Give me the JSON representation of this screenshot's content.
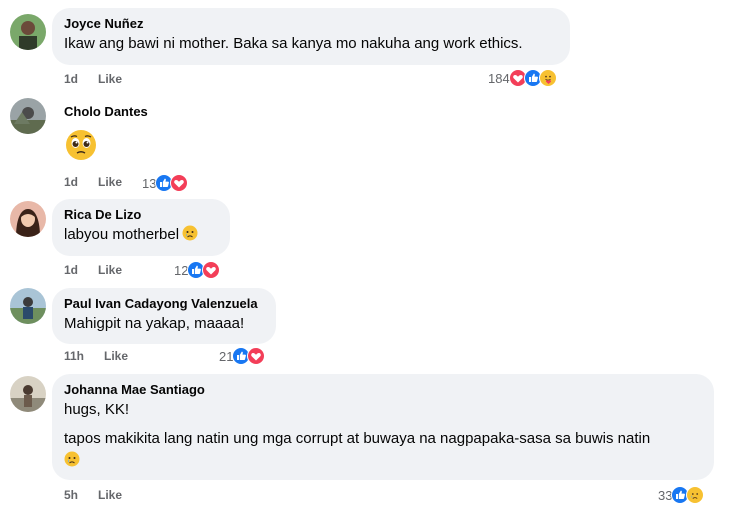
{
  "comments": [
    {
      "author": "Joyce Nuñez",
      "text": "Ikaw ang bawi ni mother. Baka sa kanya mo nakuha ang work ethics.",
      "time": "1d",
      "like_label": "Like",
      "reaction_count": "184",
      "reactions": [
        "love-icon",
        "like-icon",
        "care-icon"
      ]
    },
    {
      "author": "Cholo Dantes",
      "text": "",
      "emoji": "pleading-face",
      "time": "1d",
      "like_label": "Like",
      "reaction_count": "13",
      "reactions": [
        "like-icon",
        "love-icon"
      ]
    },
    {
      "author": "Rica De Lizo",
      "text": "labyou motherbel",
      "emoji": "crying-face",
      "time": "1d",
      "like_label": "Like",
      "reaction_count": "12",
      "reactions": [
        "like-icon",
        "love-icon"
      ]
    },
    {
      "author": "Paul Ivan Cadayong Valenzuela",
      "text": "Mahigpit na yakap, maaaa!",
      "time": "11h",
      "like_label": "Like",
      "reaction_count": "21",
      "reactions": [
        "like-icon",
        "love-icon"
      ]
    },
    {
      "author": "Johanna Mae Santiago",
      "text": "hugs, KK!",
      "text2": "tapos makikita lang natin ung mga corrupt at buwaya na nagpapaka-sasa sa buwis natin",
      "emoji": "crying-face",
      "time": "5h",
      "like_label": "Like",
      "reaction_count": "33",
      "reactions": [
        "like-icon",
        "sad-icon"
      ]
    }
  ],
  "colors": {
    "bubble": "#f0f2f5",
    "meta": "#65676b",
    "like": "#1877f2",
    "love": "#f33e58",
    "emoji": "#f7c131"
  }
}
